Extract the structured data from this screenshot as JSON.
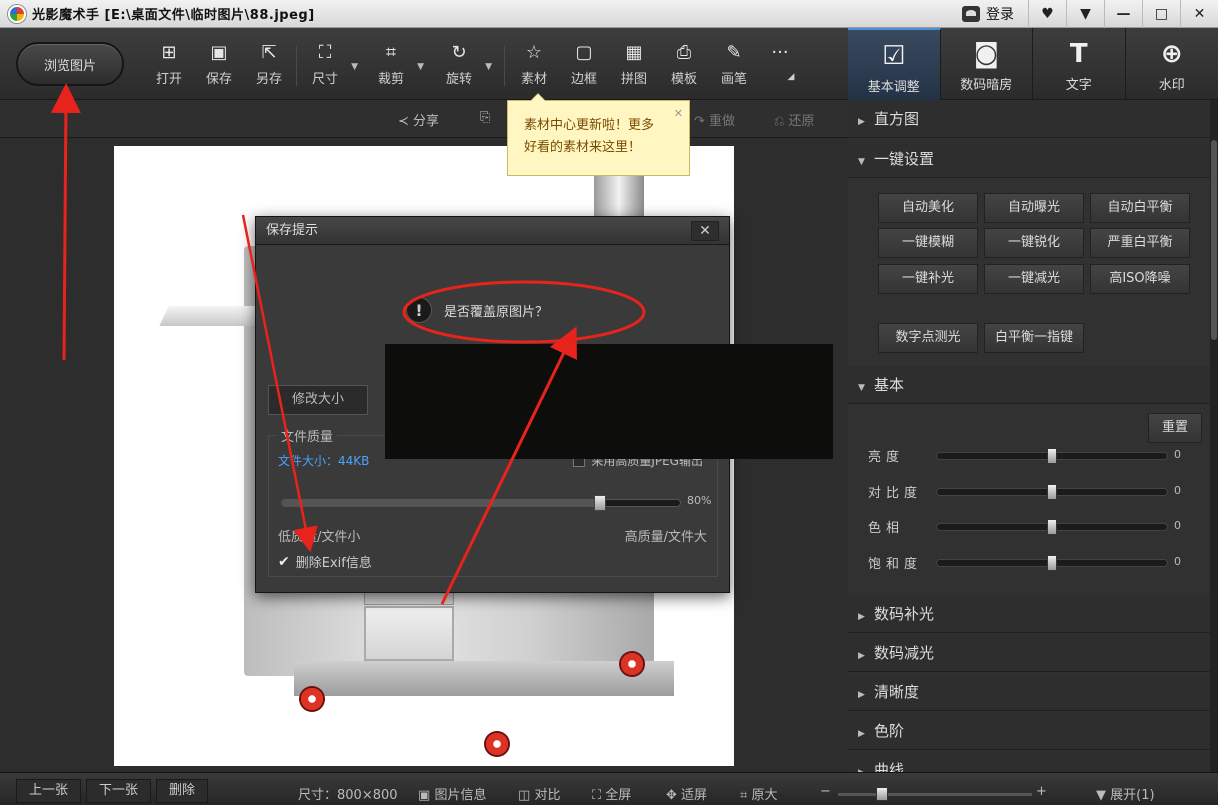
{
  "titlebar": {
    "title": "光影魔术手 [E:\\桌面文件\\临时图片\\88.jpeg]",
    "login": "登录",
    "buttons": [
      "♥",
      "▼",
      "—",
      "□",
      "✕"
    ]
  },
  "toolbar": {
    "browse": "浏览图片",
    "tools": [
      {
        "label": "打开",
        "icon": "open-icon"
      },
      {
        "label": "保存",
        "icon": "save-icon"
      },
      {
        "label": "另存",
        "icon": "save-as-icon"
      },
      {
        "label": "尺寸",
        "icon": "resize-icon"
      },
      {
        "label": "裁剪",
        "icon": "crop-icon"
      },
      {
        "label": "旋转",
        "icon": "rotate-icon"
      },
      {
        "label": "素材",
        "icon": "material-icon"
      },
      {
        "label": "边框",
        "icon": "frame-icon"
      },
      {
        "label": "拼图",
        "icon": "collage-icon"
      },
      {
        "label": "模板",
        "icon": "template-icon"
      },
      {
        "label": "画笔",
        "icon": "brush-icon"
      },
      {
        "label": "···",
        "icon": "more-icon"
      }
    ]
  },
  "right_tabs": [
    {
      "label": "基本调整",
      "icon": "adjust-icon",
      "active": true
    },
    {
      "label": "数码暗房",
      "icon": "darkroom-icon",
      "active": false
    },
    {
      "label": "文字",
      "icon": "text-icon",
      "active": false
    },
    {
      "label": "水印",
      "icon": "watermark-icon",
      "active": false
    }
  ],
  "subbar": {
    "share": "分享",
    "redo": "重做",
    "restore": "还原"
  },
  "tooltip": {
    "line1": "素材中心更新啦！更多",
    "line2": "好看的素材来这里！"
  },
  "dialog": {
    "title": "保存提示",
    "question": "是否覆盖原图片？",
    "resize_button": "修改大小",
    "quality_group": "文件质量",
    "file_size": "文件大小：44KB",
    "hq_jpeg": "采用高质量JPEG输出",
    "quality_percent": "80%",
    "quality_value": 0.8,
    "low_label": "低质量/文件小",
    "high_label": "高质量/文件大",
    "exif": "删除Exif信息",
    "exif_checked": true
  },
  "panel": {
    "histogram": "直方图",
    "oneclick": "一键设置",
    "oneclick_buttons": [
      "自动美化",
      "自动曝光",
      "自动白平衡",
      "一键模糊",
      "一键锐化",
      "严重白平衡",
      "一键补光",
      "一键减光",
      "高ISO降噪"
    ],
    "extra_buttons": [
      "数字点测光",
      "白平衡一指键"
    ],
    "basic": "基本",
    "reset": "重置",
    "sliders": [
      {
        "label": "亮度",
        "value": "0"
      },
      {
        "label": "对比度",
        "value": "0"
      },
      {
        "label": "色相",
        "value": "0"
      },
      {
        "label": "饱和度",
        "value": "0"
      }
    ],
    "collapsed_sections": [
      "数码补光",
      "数码减光",
      "清晰度",
      "色阶",
      "曲线"
    ]
  },
  "statusbar": {
    "prev": "上一张",
    "next": "下一张",
    "delete": "删除",
    "size": "尺寸：800×800",
    "info": "图片信息",
    "compare": "对比",
    "fullscreen": "全屏",
    "fit": "适屏",
    "original": "原大",
    "minus": "−",
    "plus": "+",
    "expand": "展开(1)"
  }
}
